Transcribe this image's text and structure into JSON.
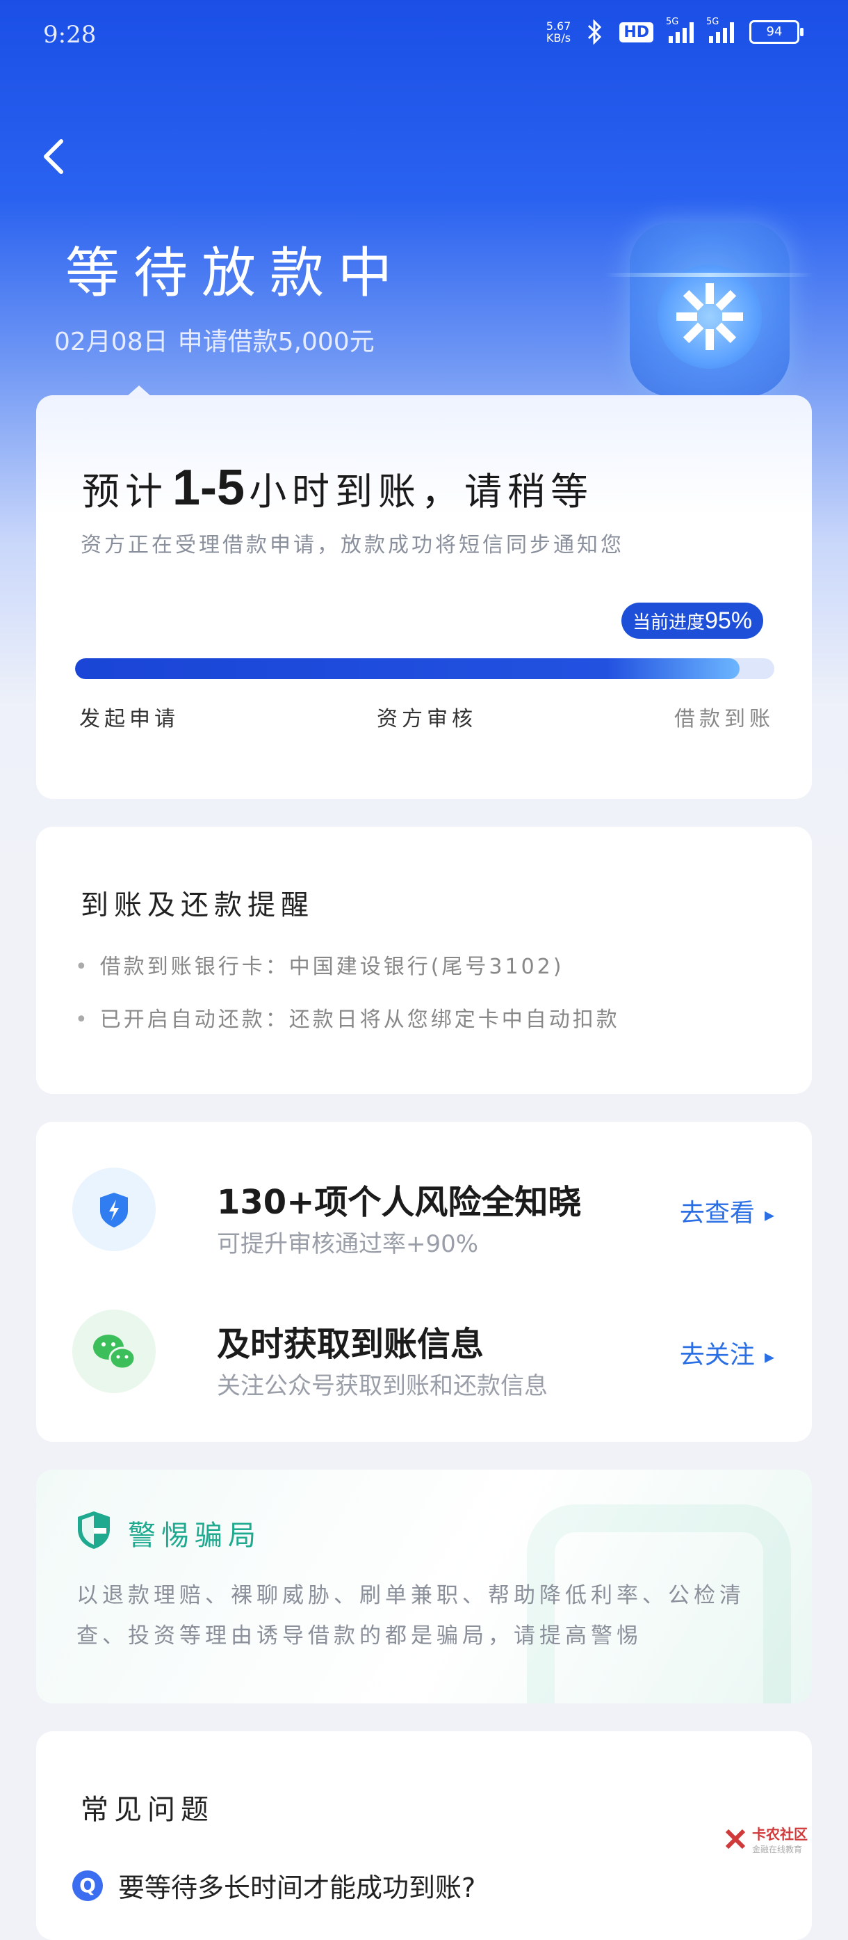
{
  "status_bar": {
    "time": "9:28",
    "net_speed": "5.67",
    "net_unit": "KB/s",
    "hd": "HD",
    "sig1": "5G",
    "sig2": "5G",
    "battery": "94"
  },
  "header": {
    "title": "等待放款中",
    "subtitle_date": "02月08日",
    "subtitle_action": "申请借款",
    "subtitle_amount": "5,000",
    "subtitle_unit": "元"
  },
  "progress_card": {
    "eta_prefix": "预计",
    "eta_range": "1-5",
    "eta_suffix": "小时到账，请稍等",
    "description": "资方正在受理借款申请，放款成功将短信同步通知您",
    "badge_label": "当前进度",
    "badge_value": "95%",
    "progress": 0.95,
    "steps": [
      "发起申请",
      "资方审核",
      "借款到账"
    ]
  },
  "reminder": {
    "title": "到账及还款提醒",
    "items": [
      "借款到账银行卡：中国建设银行(尾号3102)",
      "已开启自动还款：还款日将从您绑定卡中自动扣款"
    ]
  },
  "actions": [
    {
      "icon": "shield-bolt-icon",
      "title": "130+项个人风险全知晓",
      "subtitle": "可提升审核通过率+90%",
      "link": "去查看"
    },
    {
      "icon": "wechat-icon",
      "title": "及时获取到账信息",
      "subtitle": "关注公众号获取到账和还款信息",
      "link": "去关注"
    }
  ],
  "warning": {
    "title": "警惕骗局",
    "text": "以退款理赔、裸聊威胁、刷单兼职、帮助降低利率、公检清查、投资等理由诱导借款的都是骗局，请提高警惕"
  },
  "faq": {
    "title": "常见问题",
    "q_icon": "Q",
    "question": "要等待多长时间才能成功到账?"
  },
  "watermark": {
    "brand": "卡农社区",
    "slogan": "金融在线教育"
  },
  "colors": {
    "primary": "#1d4fd8",
    "link": "#2b6fe4",
    "warn": "#1fa98f"
  }
}
